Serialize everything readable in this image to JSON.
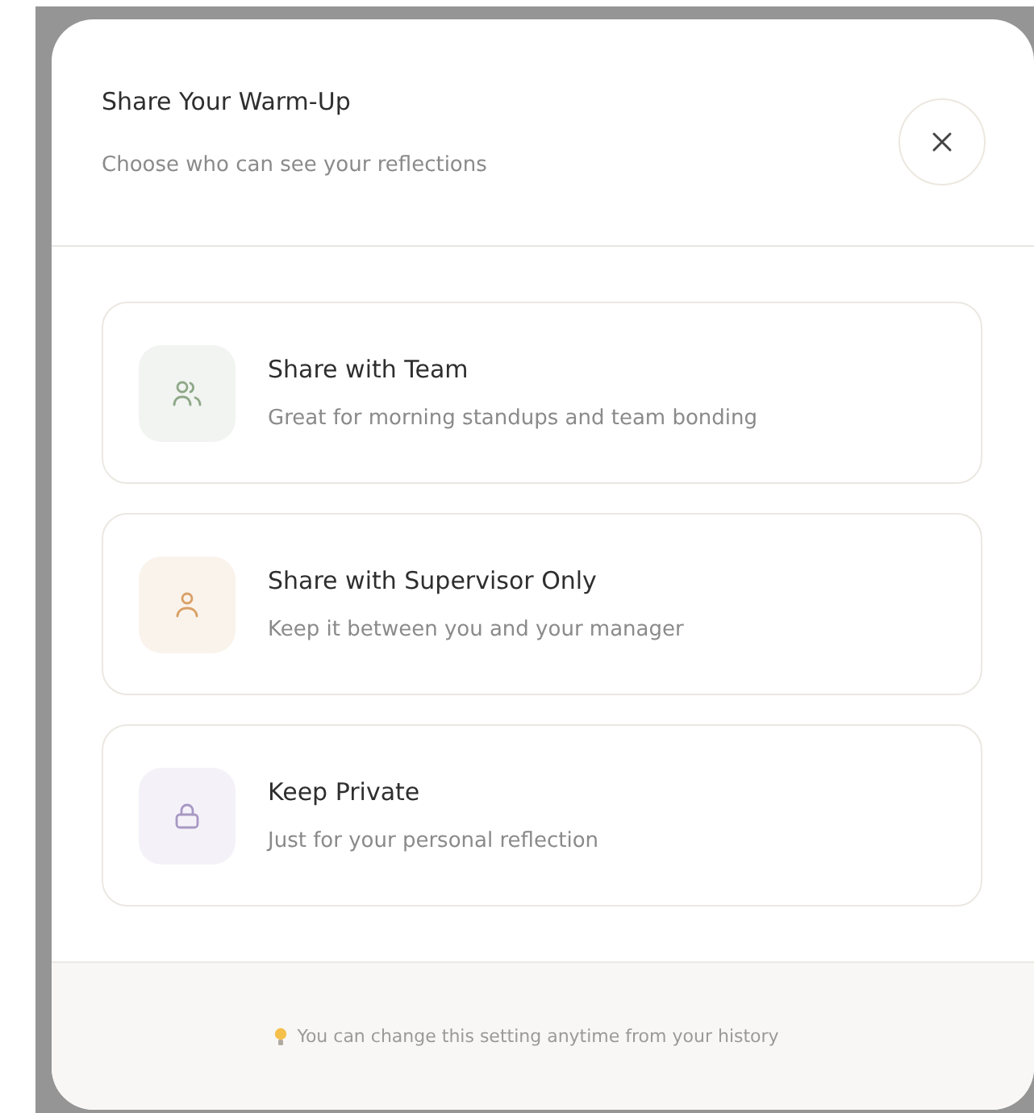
{
  "dialog": {
    "title": "Share Your Warm-Up",
    "subtitle": "Choose who can see your reflections"
  },
  "options": [
    {
      "kind": "team",
      "title": "Share with Team",
      "description": "Great for morning standups and team bonding",
      "color": "#8fa888"
    },
    {
      "kind": "supervisor",
      "title": "Share with Supervisor Only",
      "description": "Keep it between you and your manager",
      "color": "#d9a066"
    },
    {
      "kind": "private",
      "title": "Keep Private",
      "description": "Just for your personal reflection",
      "color": "#a898c4"
    }
  ],
  "footer": {
    "note": "You can change this setting anytime from your history"
  }
}
